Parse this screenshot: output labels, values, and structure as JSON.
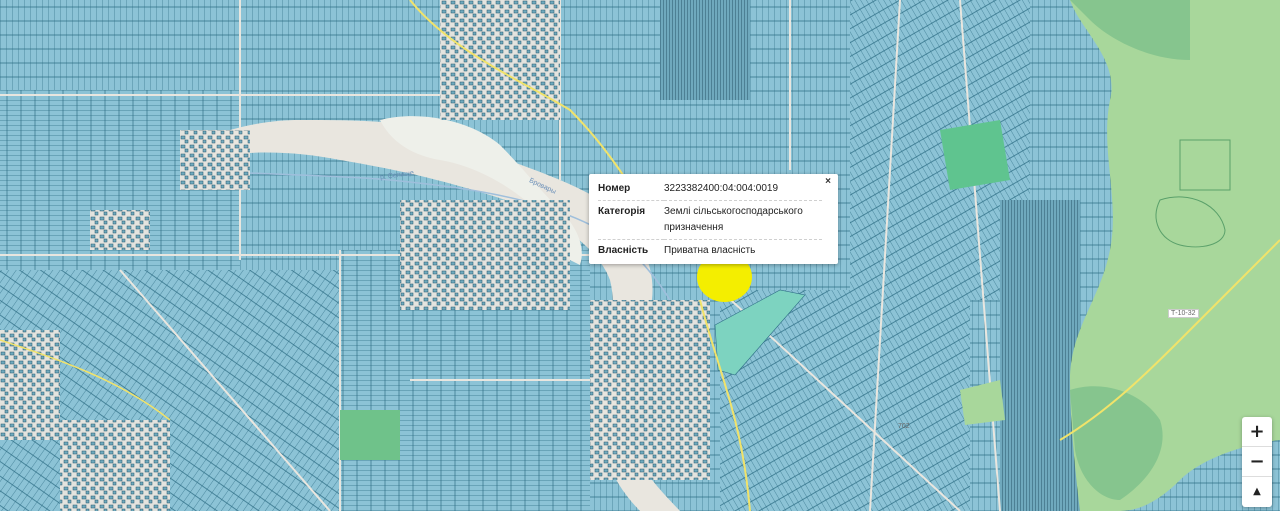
{
  "popup": {
    "close": "×",
    "rows": [
      {
        "key": "Номер",
        "value": "3223382400:04:004:0019"
      },
      {
        "key": "Категорія",
        "value": "Землі сільськогосподарського призначення"
      },
      {
        "key": "Власність",
        "value": "Приватна власність"
      }
    ]
  },
  "map_labels": {
    "road_t1032": "Т-10-32",
    "road_702": "702",
    "river_1": "Бровары",
    "river_2": "р. Селище"
  },
  "controls": {
    "zoom_in": "+",
    "zoom_out": "−",
    "north": "▲"
  },
  "colors": {
    "parcel_fill": "#8cc3d6",
    "parcel_line": "#2f6f86",
    "forest": "#a8d79b",
    "forest_dark": "#86c58e",
    "teal_parcel": "#7dd3c0",
    "background": "#e9e6df",
    "marker": "#f4ee00",
    "road": "#f1e36a"
  }
}
